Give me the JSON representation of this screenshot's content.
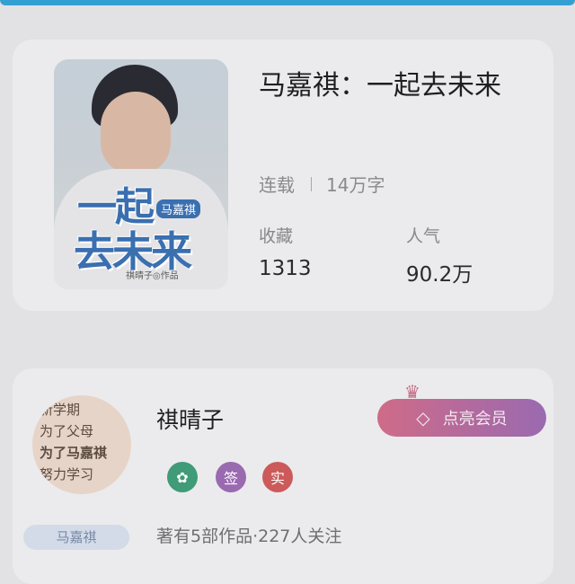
{
  "colors": {
    "accent_blue": "#34a0d2",
    "member_start": "#cf6b88",
    "member_end": "#9a6ab0",
    "badge_green": "#3f9b78",
    "badge_purple": "#9a6ab0",
    "badge_red": "#cc5a5a"
  },
  "book": {
    "title": "马嘉祺：一起去未来",
    "status": "连载",
    "word_count": "14万字",
    "stats": [
      {
        "label": "收藏",
        "value": "1313"
      },
      {
        "label": "人气",
        "value": "90.2万"
      }
    ],
    "cover": {
      "title_line1": "一起",
      "title_line2": "去未来",
      "tag": "马嘉祺",
      "author": "祺晴子◎作品"
    }
  },
  "author": {
    "name": "祺晴子",
    "member_button": "点亮会员",
    "badges": [
      {
        "icon": "verified-icon",
        "text": ""
      },
      {
        "icon": "signed-icon",
        "text": "签"
      },
      {
        "icon": "realname-icon",
        "text": "实"
      }
    ],
    "avatar_lines": [
      "新学期",
      "为了父母",
      "为了马嘉祺",
      "努力学习"
    ],
    "avatar_badge": "马嘉祺",
    "works_follow": "著有5部作品·227人关注"
  }
}
